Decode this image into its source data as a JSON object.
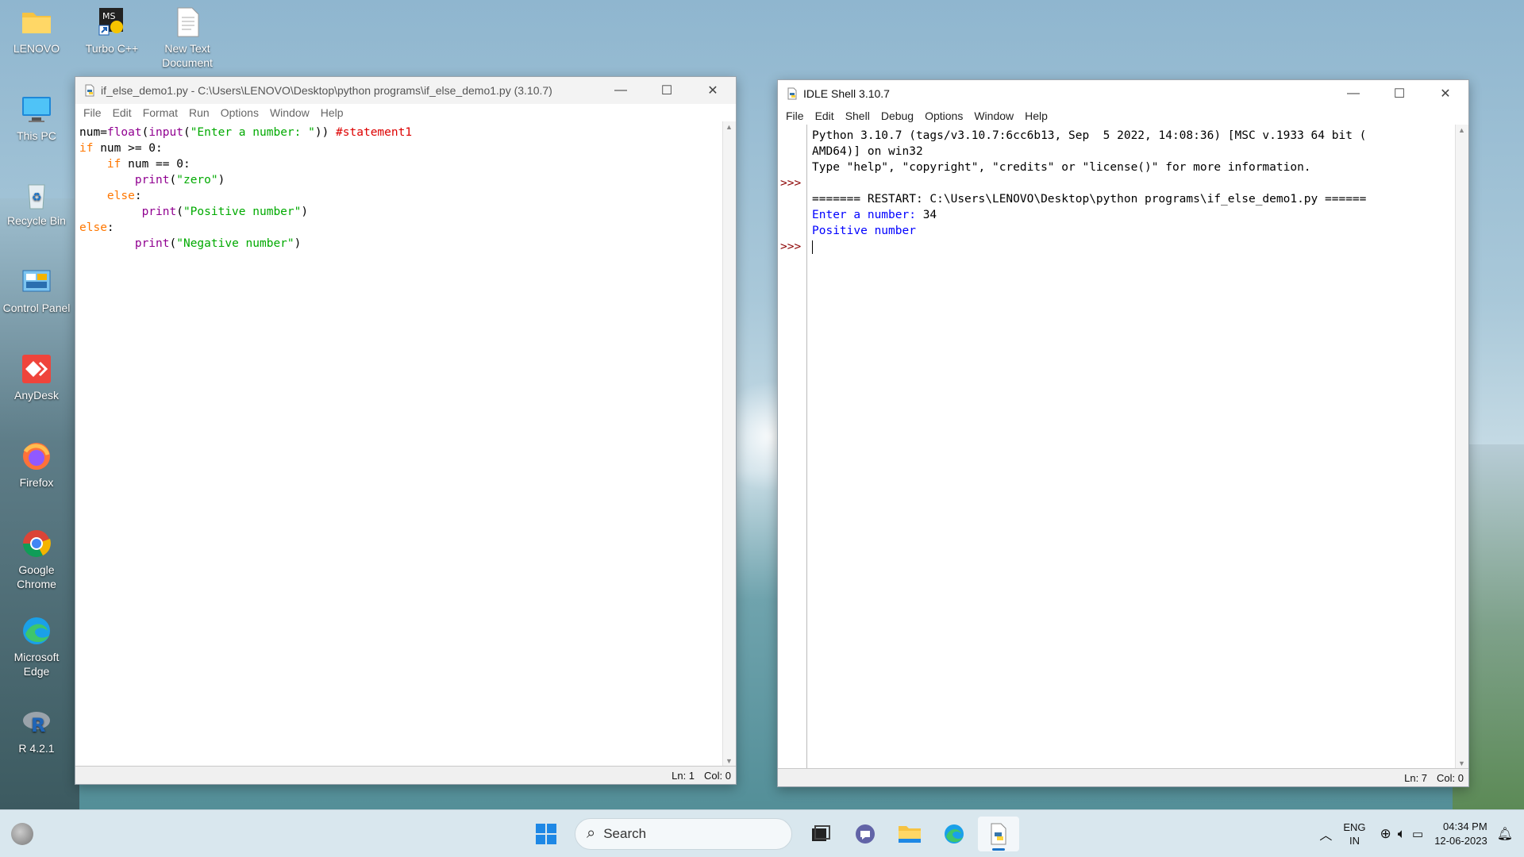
{
  "desktop_icons": [
    {
      "label": "LENOVO",
      "icon": "folder-icon"
    },
    {
      "label": "Turbo C++",
      "icon": "turbo-cpp-icon"
    },
    {
      "label": "New Text Document",
      "icon": "text-document-icon"
    },
    {
      "label": "This PC",
      "icon": "monitor-icon"
    },
    {
      "label": "Recycle Bin",
      "icon": "recycle-bin-icon"
    },
    {
      "label": "Control Panel",
      "icon": "control-panel-icon"
    },
    {
      "label": "AnyDesk",
      "icon": "anydesk-icon"
    },
    {
      "label": "Firefox",
      "icon": "firefox-icon"
    },
    {
      "label": "Google Chrome",
      "icon": "chrome-icon"
    },
    {
      "label": "Microsoft Edge",
      "icon": "edge-icon"
    },
    {
      "label": "R 4.2.1",
      "icon": "r-icon"
    }
  ],
  "editor": {
    "title": "if_else_demo1.py - C:\\Users\\LENOVO\\Desktop\\python programs\\if_else_demo1.py (3.10.7)",
    "menu": [
      "File",
      "Edit",
      "Format",
      "Run",
      "Options",
      "Window",
      "Help"
    ],
    "status": {
      "ln": "Ln: 1",
      "col": "Col: 0"
    },
    "code": {
      "l1_a": "num=",
      "l1_b": "float",
      "l1_c": "(",
      "l1_d": "input",
      "l1_e": "(",
      "l1_f": "\"Enter a number: \"",
      "l1_g": ")) ",
      "l1_h": "#statement1",
      "l2_a": "if",
      "l2_b": " num >= 0:",
      "l3_a": "    if",
      "l3_b": " num == 0:",
      "l4_a": "        print",
      "l4_b": "(",
      "l4_c": "\"zero\"",
      "l4_d": ")",
      "l5_a": "    else",
      "l5_b": ":",
      "l6_a": "         print",
      "l6_b": "(",
      "l6_c": "\"Positive number\"",
      "l6_d": ")",
      "l7_a": "else",
      "l7_b": ":",
      "l8_a": "        print",
      "l8_b": "(",
      "l8_c": "\"Negative number\"",
      "l8_d": ")"
    }
  },
  "shell": {
    "title": "IDLE Shell 3.10.7",
    "menu": [
      "File",
      "Edit",
      "Shell",
      "Debug",
      "Options",
      "Window",
      "Help"
    ],
    "status": {
      "ln": "Ln: 7",
      "col": "Col: 0"
    },
    "prompt": ">>>",
    "lines": {
      "banner1": "Python 3.10.7 (tags/v3.10.7:6cc6b13, Sep  5 2022, 14:08:36) [MSC v.1933 64 bit (",
      "banner2": "AMD64)] on win32",
      "banner3": "Type \"help\", \"copyright\", \"credits\" or \"license()\" for more information.",
      "restart": "======= RESTART: C:\\Users\\LENOVO\\Desktop\\python programs\\if_else_demo1.py ======",
      "input_prompt": "Enter a number: ",
      "input_value": "34",
      "output": "Positive number"
    }
  },
  "taskbar": {
    "search_label": "Search",
    "lang_line1": "ENG",
    "lang_line2": "IN",
    "time": "04:34 PM",
    "date": "12-06-2023"
  },
  "colors": {
    "keyword": "#ff7700",
    "builtin": "#900090",
    "string": "#00aa00",
    "comment": "#dd0000",
    "output": "#0000ff",
    "prompt": "#8b0000"
  }
}
